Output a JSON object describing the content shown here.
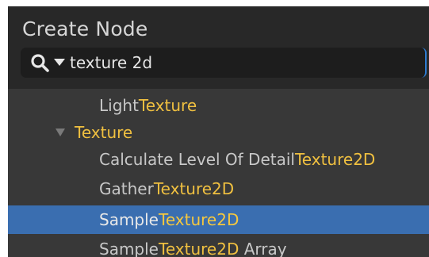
{
  "window": {
    "title": "Create Node"
  },
  "search": {
    "value": "texture 2d",
    "icon": "search-icon",
    "dropdown_icon": "chevron-down-icon"
  },
  "results": [
    {
      "plain": "Light",
      "highlight": "Texture",
      "suffix": "",
      "kind": "item",
      "selected": false
    },
    {
      "plain": "",
      "highlight": "Texture",
      "suffix": "",
      "kind": "category",
      "expanded": true,
      "selected": false
    },
    {
      "plain": "Calculate Level Of Detail",
      "highlight": "Texture2D",
      "suffix": "",
      "kind": "item",
      "selected": false
    },
    {
      "plain": "Gather",
      "highlight": "Texture2D",
      "suffix": "",
      "kind": "item",
      "selected": false
    },
    {
      "plain": "Sample",
      "highlight": "Texture2D",
      "suffix": "",
      "kind": "item",
      "selected": true
    },
    {
      "plain": "Sample",
      "highlight": "Texture2D",
      "suffix": " Array",
      "kind": "item",
      "selected": false
    }
  ],
  "colors": {
    "panel_bg": "#383838",
    "header_bg": "#282828",
    "search_bg": "#1d1d1d",
    "selection_bg": "#3a6eb0",
    "match_highlight": "#f0c040",
    "text": "#c8c8c8"
  }
}
